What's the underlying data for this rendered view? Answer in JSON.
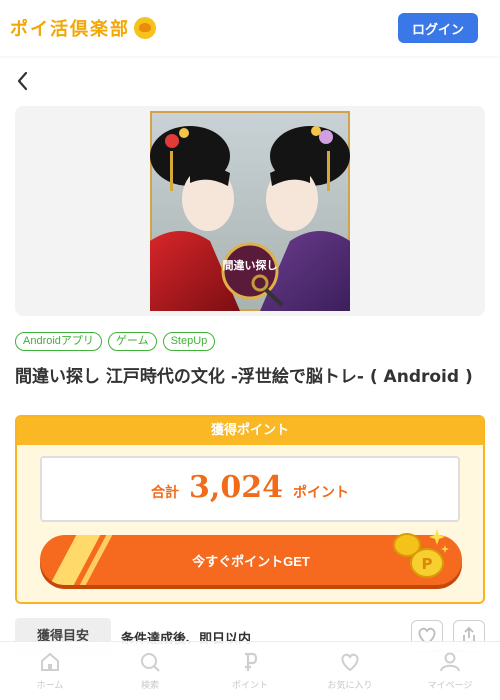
{
  "header": {
    "logo_text": "ポイ活倶楽部",
    "login_label": "ログイン"
  },
  "hero": {
    "image_label": "間違い探し"
  },
  "tags": [
    "Androidアプリ",
    "ゲーム",
    "StepUp"
  ],
  "title": "間違い探し 江戸時代の文化 -浮世絵で脳トレ- ( Android )",
  "points": {
    "heading": "獲得ポイント",
    "total_label": "合計",
    "total_value": "3,024",
    "unit": "ポイント",
    "get_button_label": "今すぐポイントGET"
  },
  "criteria": {
    "tab_label": "獲得目安",
    "text": "条件達成後、即日以内"
  },
  "tabbar": [
    {
      "label": "ホーム",
      "icon": "home-icon"
    },
    {
      "label": "検索",
      "icon": "search-icon"
    },
    {
      "label": "ポイント",
      "icon": "point-icon"
    },
    {
      "label": "お気に入り",
      "icon": "heart-icon"
    },
    {
      "label": "マイページ",
      "icon": "user-icon"
    }
  ],
  "colors": {
    "brand": "#f2a705",
    "login": "#3b78e7",
    "tag": "#3fb238",
    "points_orange": "#f06b1a",
    "header_yellow": "#f9b824"
  }
}
